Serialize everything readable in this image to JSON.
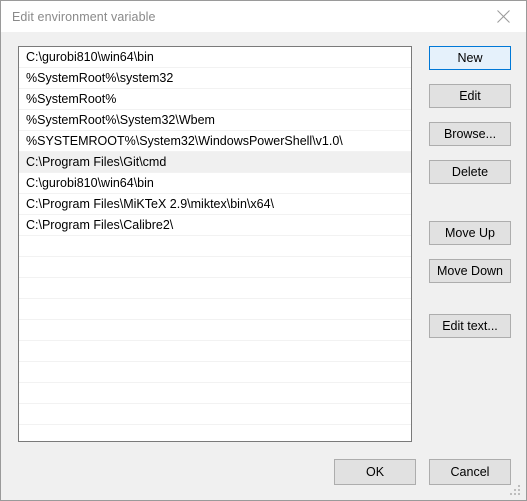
{
  "window": {
    "title": "Edit environment variable",
    "close_icon": "close-icon"
  },
  "path_list": {
    "entries": [
      "C:\\gurobi810\\win64\\bin",
      "%SystemRoot%\\system32",
      "%SystemRoot%",
      "%SystemRoot%\\System32\\Wbem",
      "%SYSTEMROOT%\\System32\\WindowsPowerShell\\v1.0\\",
      "C:\\Program Files\\Git\\cmd",
      "C:\\gurobi810\\win64\\bin",
      "C:\\Program Files\\MiKTeX 2.9\\miktex\\bin\\x64\\",
      "C:\\Program Files\\Calibre2\\"
    ],
    "selected_index": 5,
    "empty_row_count": 10
  },
  "side_buttons": {
    "new": "New",
    "edit": "Edit",
    "browse": "Browse...",
    "delete": "Delete",
    "move_up": "Move Up",
    "move_down": "Move Down",
    "edit_text": "Edit text..."
  },
  "bottom_buttons": {
    "ok": "OK",
    "cancel": "Cancel"
  },
  "colors": {
    "accent": "#0078d7",
    "focus_fill": "#e5f1fb",
    "dialog_bg": "#f0f0f0",
    "button_face": "#e1e1e1",
    "button_border": "#adadad",
    "listbox_border": "#7a7a7a",
    "title_text": "#8a8a8a",
    "selected_row_bg": "#f0f0f0"
  }
}
